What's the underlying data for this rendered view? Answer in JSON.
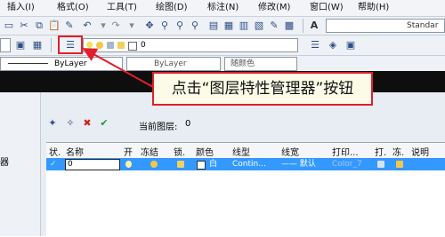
{
  "menubar": {
    "items": [
      "插入(I)",
      "格式(O)",
      "工具(T)",
      "绘图(D)",
      "标注(N)",
      "修改(M)",
      "窗口(W)",
      "帮助(H)"
    ]
  },
  "toolbar1": {
    "style_label": "Standar"
  },
  "toolbar2": {
    "layer_combo_value": "0"
  },
  "toolbar3": {
    "linetype_value": "ByLayer",
    "lineweight_value": "ByLayer",
    "color_value": "随颜色"
  },
  "callout": {
    "text": "点击“图层特性管理器”按钮"
  },
  "layer_panel": {
    "current_layer_label": "当前图层:",
    "current_layer_value": "0",
    "columns": [
      "状.",
      "名称",
      "开",
      "冻结",
      "锁.",
      "颜色",
      "线型",
      "线宽",
      "打印...",
      "打.",
      "冻.",
      "说明"
    ],
    "rows": [
      {
        "status": "✓",
        "name": "0",
        "color": "白",
        "linetype": "Contin...",
        "lineweight": "—— 默认",
        "plotstyle": "Color_7"
      }
    ]
  },
  "left_panel": {
    "label": "器"
  },
  "colors": {
    "accent_red": "#e0202a",
    "selection_blue": "#3399ff",
    "toolbar_bg": "#eef1f5"
  }
}
